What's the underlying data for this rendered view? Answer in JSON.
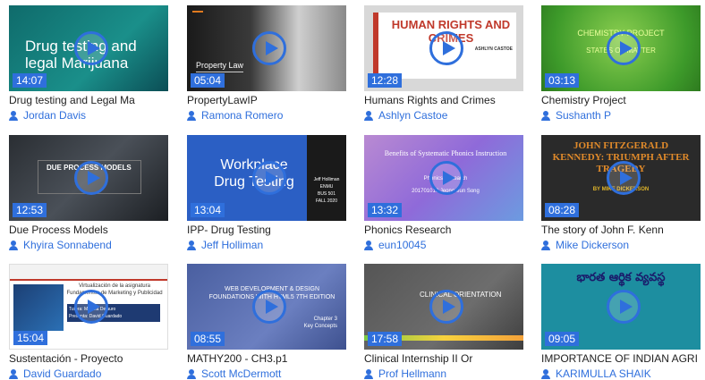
{
  "videos": [
    {
      "title": "Drug testing and Legal Ma",
      "author": "Jordan Davis",
      "duration": "14:07",
      "thumb_text": "Drug testing and legal Marijuana",
      "thumb_sub": ""
    },
    {
      "title": "PropertyLawIP",
      "author": "Ramona Romero",
      "duration": "05:04",
      "thumb_text": "Property Law",
      "thumb_sub": ""
    },
    {
      "title": "Humans Rights and Crimes",
      "author": "Ashlyn Castoe",
      "duration": "12:28",
      "thumb_text": "HUMAN RIGHTS AND CRIMES",
      "thumb_sub": "ASHLYN CASTOE"
    },
    {
      "title": "Chemistry Project",
      "author": "Sushanth P",
      "duration": "03:13",
      "thumb_text": "CHEMISTRY PROJECT",
      "thumb_sub": "STATES OF MATTER"
    },
    {
      "title": "Due Process Models",
      "author": "Khyira Sonnabend",
      "duration": "12:53",
      "thumb_text": "DUE PROCESS MODELS",
      "thumb_sub": ""
    },
    {
      "title": "IPP- Drug Testing",
      "author": "Jeff Holliman",
      "duration": "13:04",
      "thumb_text": "Workplace Drug Testing",
      "thumb_sub": "Jeff Holliman\nENMU\nBUS 501\nFALL 2020"
    },
    {
      "title": "Phonics Research",
      "author": "eun10045",
      "duration": "13:32",
      "thumb_text": "Benefits of Systematic Phonics Instruction",
      "thumb_sub": "Phonics Research\n201701010 Jeong-eun Song"
    },
    {
      "title": "The story of John F. Kenn",
      "author": "Mike Dickerson",
      "duration": "08:28",
      "thumb_text": "JOHN FITZGERALD KENNEDY: TRIUMPH AFTER TRAGEDY",
      "thumb_sub": "BY MIKE DICKERSON"
    },
    {
      "title": "Sustentación - Proyecto",
      "author": "David Guardado",
      "duration": "15:04",
      "thumb_text": "Virtualización de la asignatura Fundamentos de Marketing y Publicidad",
      "thumb_sub": "Tutora: Mariela Delauro\nPresenta: David Guardado"
    },
    {
      "title": "MATHY200 - CH3.p1",
      "author": "Scott McDermott",
      "duration": "08:55",
      "thumb_text": "WEB DEVELOPMENT & DESIGN FOUNDATIONS WITH HTML5 7TH EDITION",
      "thumb_sub": "Chapter 3\nKey Concepts"
    },
    {
      "title": "Clinical Internship II Or",
      "author": "Prof Hellmann",
      "duration": "17:58",
      "thumb_text": "CLINICAL ORIENTATION",
      "thumb_sub": ""
    },
    {
      "title": "IMPORTANCE OF INDIAN AGRI",
      "author": "KARIMULLA SHAIK",
      "duration": "09:05",
      "thumb_text": "భారత ఆర్థిక వ్యవస్థ",
      "thumb_sub": ""
    }
  ]
}
